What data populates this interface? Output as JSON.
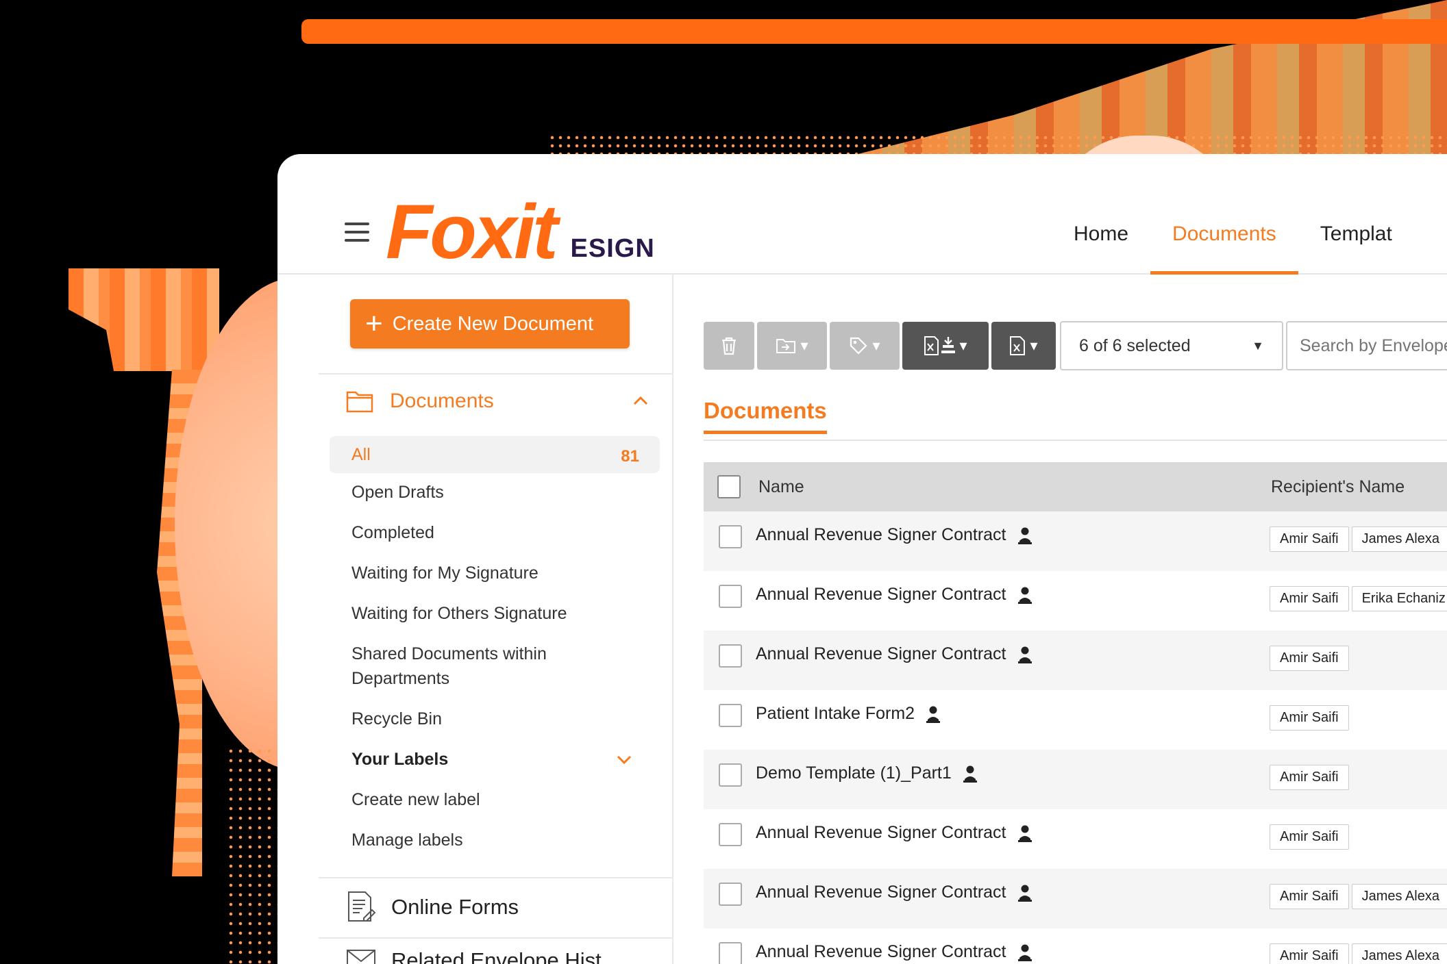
{
  "brand": {
    "logo": "Foxit",
    "product": "ESIGN"
  },
  "topnav": [
    {
      "label": "Home",
      "active": false
    },
    {
      "label": "Documents",
      "active": true
    },
    {
      "label": "Templat",
      "active": false
    }
  ],
  "sidebar": {
    "create_button": "Create New Document",
    "documents_section": "Documents",
    "items": [
      {
        "label": "All",
        "count": "81"
      },
      {
        "label": "Open Drafts"
      },
      {
        "label": "Completed"
      },
      {
        "label": "Waiting for My Signature"
      },
      {
        "label": "Waiting for Others Signature"
      },
      {
        "label": "Shared Documents within Departments"
      },
      {
        "label": "Recycle Bin"
      }
    ],
    "labels_header": "Your Labels",
    "label_items": [
      "Create new label",
      "Manage labels"
    ],
    "online_forms": "Online Forms",
    "next_section": "Related Envelope Hist"
  },
  "toolbar": {
    "selected": "6 of 6 selected",
    "search_placeholder": "Search by Envelope"
  },
  "main": {
    "tab_title": "Documents",
    "columns": {
      "name": "Name",
      "recipient": "Recipient's Name"
    },
    "rows": [
      {
        "name": "Annual Revenue Signer Contract",
        "recipients": [
          "Amir Saifi",
          "James Alexa"
        ]
      },
      {
        "name": "Annual Revenue Signer Contract",
        "recipients": [
          "Amir Saifi",
          "Erika Echaniz"
        ]
      },
      {
        "name": "Annual Revenue Signer Contract",
        "recipients": [
          "Amir Saifi"
        ]
      },
      {
        "name": "Patient Intake Form2",
        "recipients": [
          "Amir Saifi"
        ]
      },
      {
        "name": "Demo Template (1)_Part1",
        "recipients": [
          "Amir Saifi"
        ]
      },
      {
        "name": "Annual Revenue Signer Contract",
        "recipients": [
          "Amir Saifi"
        ]
      },
      {
        "name": "Annual Revenue Signer Contract",
        "recipients": [
          "Amir Saifi",
          "James Alexa"
        ]
      },
      {
        "name": "Annual Revenue Signer Contract",
        "recipients": [
          "Amir Saifi",
          "James Alexa"
        ]
      }
    ]
  },
  "colors": {
    "accent": "#f47b20",
    "brand": "#ff6a13",
    "toolbar_dark": "#555555",
    "toolbar_light": "#bfbfbf"
  }
}
